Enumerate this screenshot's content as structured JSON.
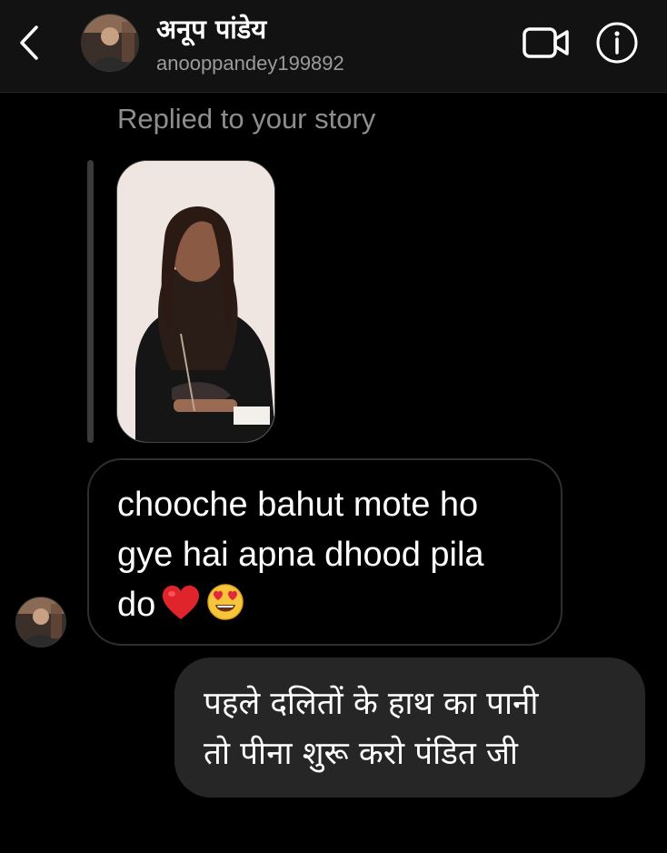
{
  "header": {
    "name": "अनूप पांडेय",
    "username": "anooppandey199892",
    "back_icon": "chevron-left-icon",
    "video_icon": "video-camera-icon",
    "info_icon": "info-icon"
  },
  "thread": {
    "story_reply_label": "Replied to your story",
    "incoming_message": {
      "text": "chooche bahut mote ho\ngye hai apna dhood pila\ndo",
      "emojis": [
        "red-heart-emoji",
        "heart-eyes-emoji"
      ]
    },
    "outgoing_message": {
      "text": "पहले दलितों के हाथ का पानी\nतो पीना शुरू करो पंडित जी"
    }
  },
  "colors": {
    "background": "#000000",
    "header_background": "#121212",
    "secondary_text": "#8e8e8e",
    "outgoing_bubble": "#262626",
    "incoming_bubble_border": "#2e2e2e"
  }
}
